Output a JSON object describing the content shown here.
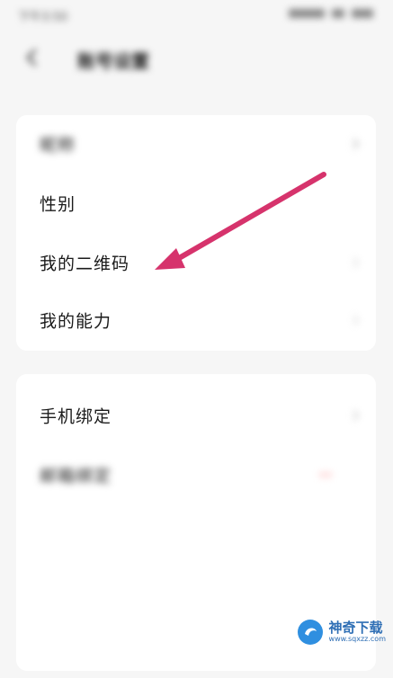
{
  "status_bar": {
    "time": "下午3:50"
  },
  "header": {
    "title": "账号设置"
  },
  "section1": {
    "items": [
      {
        "label": "昵称",
        "value": ""
      },
      {
        "label": "性别"
      },
      {
        "label": "我的二维码"
      },
      {
        "label": "我的能力"
      }
    ]
  },
  "section2": {
    "items": [
      {
        "label": "手机绑定",
        "value": ""
      },
      {
        "label": "邮箱绑定",
        "badge": ""
      },
      {
        "label": ""
      },
      {
        "label": ""
      },
      {
        "label": ""
      }
    ]
  },
  "annotation": {
    "arrow_color": "#d6336c"
  },
  "watermark": {
    "name": "神奇下载",
    "url": "www.sqxzz.com"
  }
}
